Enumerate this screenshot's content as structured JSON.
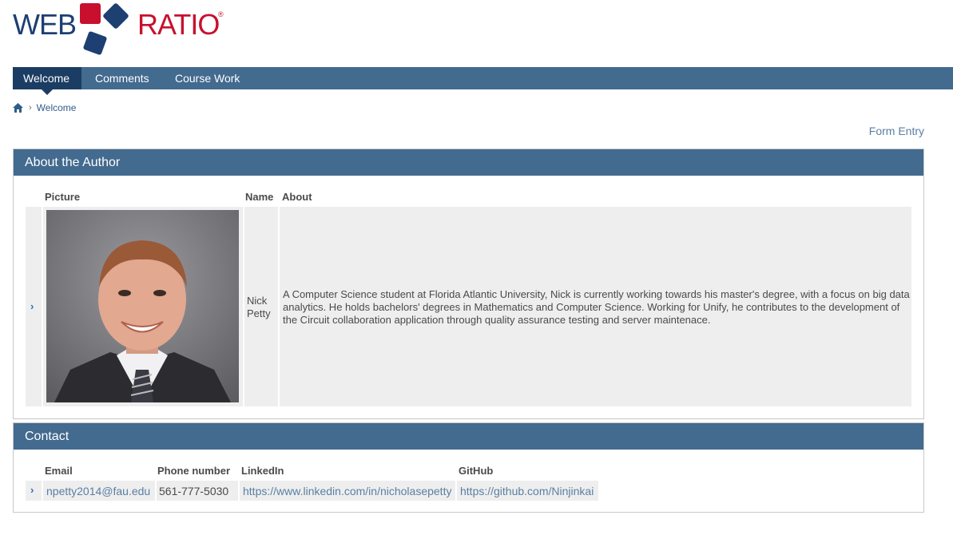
{
  "logo": {
    "left_word": "WEB",
    "right_word": "RATIO",
    "registered": "®"
  },
  "nav": {
    "tabs": [
      {
        "label": "Welcome",
        "active": true
      },
      {
        "label": "Comments",
        "active": false
      },
      {
        "label": "Course Work",
        "active": false
      }
    ]
  },
  "breadcrumb": {
    "current": "Welcome",
    "separator": "›"
  },
  "form_entry": "Form Entry",
  "about": {
    "title": "About the Author",
    "columns": {
      "picture": "Picture",
      "name": "Name",
      "about": "About"
    },
    "row": {
      "name_first": "Nick",
      "name_last": "Petty",
      "about": "A Computer Science student at Florida Atlantic University, Nick is currently working towards his master's degree, with a focus on big data analytics.  He holds bachelors' degrees in Mathematics and Computer Science.  Working for Unify, he contributes to the development of the Circuit collaboration application through quality assurance testing and server maintenace."
    }
  },
  "contact": {
    "title": "Contact",
    "columns": {
      "email": "Email",
      "phone": "Phone number",
      "linkedin": "LinkedIn",
      "github": "GitHub"
    },
    "row": {
      "email": "npetty2014@fau.edu",
      "phone": "561-777-5030",
      "linkedin": "https://www.linkedin.com/in/nicholasepetty",
      "github": "https://github.com/Ninjinkai"
    }
  },
  "colors": {
    "nav_bar": "#436a8f",
    "nav_active": "#1c3d63",
    "logo_blue": "#1d3f72",
    "logo_red": "#c8102e",
    "link": "#5a7fa3"
  }
}
